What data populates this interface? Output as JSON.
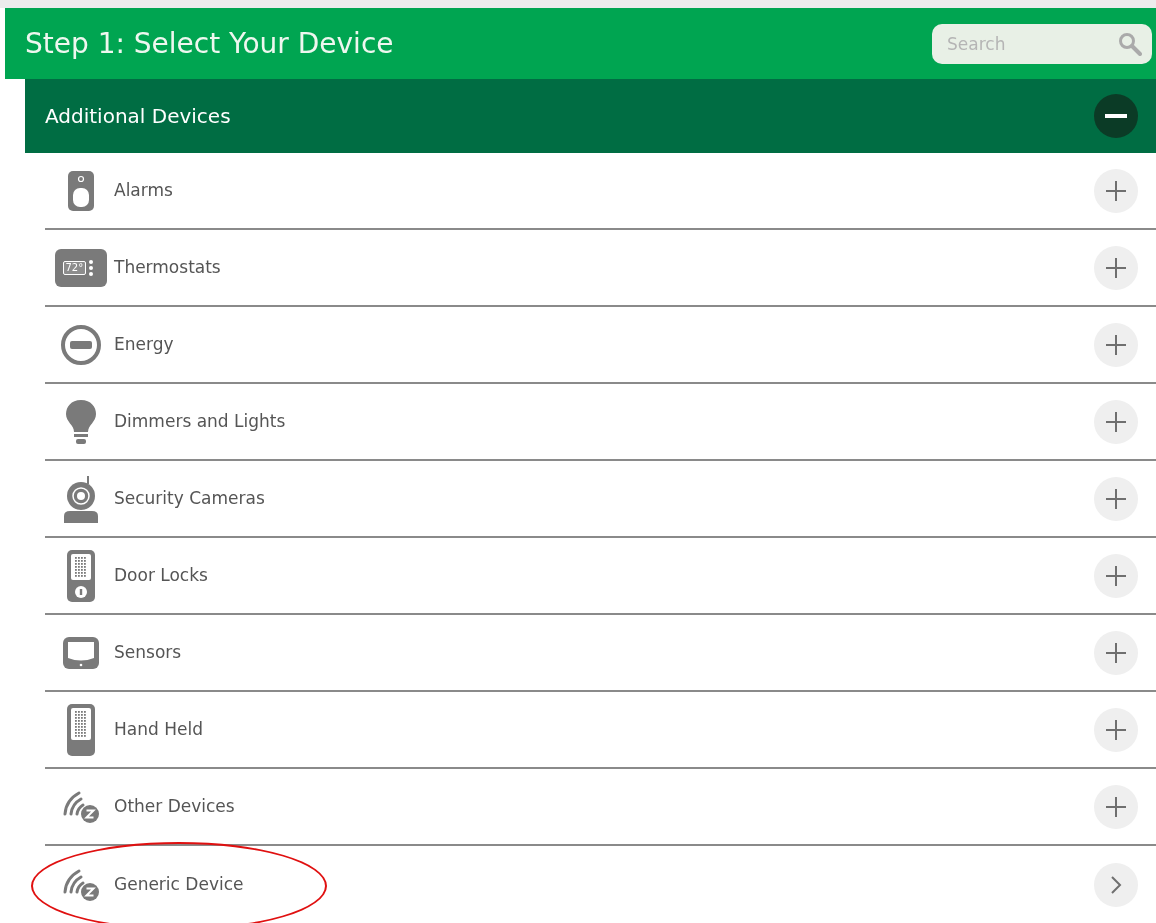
{
  "header": {
    "title": "Step 1: Select Your Device",
    "search": {
      "placeholder": "Search"
    }
  },
  "section": {
    "title": "Additional Devices",
    "expanded": true
  },
  "devices": [
    {
      "label": "Alarms",
      "kind": "expand",
      "highlighted": false
    },
    {
      "label": "Thermostats",
      "icon_text": "72°",
      "kind": "expand",
      "highlighted": false
    },
    {
      "label": "Energy",
      "kind": "expand",
      "highlighted": false
    },
    {
      "label": "Dimmers and Lights",
      "kind": "expand",
      "highlighted": false
    },
    {
      "label": "Security Cameras",
      "kind": "expand",
      "highlighted": false
    },
    {
      "label": "Door Locks",
      "kind": "expand",
      "highlighted": false
    },
    {
      "label": "Sensors",
      "kind": "expand",
      "highlighted": false
    },
    {
      "label": "Hand Held",
      "kind": "expand",
      "highlighted": false
    },
    {
      "label": "Other Devices",
      "kind": "expand",
      "highlighted": false
    },
    {
      "label": "Generic Device",
      "kind": "navigate",
      "highlighted": true
    }
  ]
}
